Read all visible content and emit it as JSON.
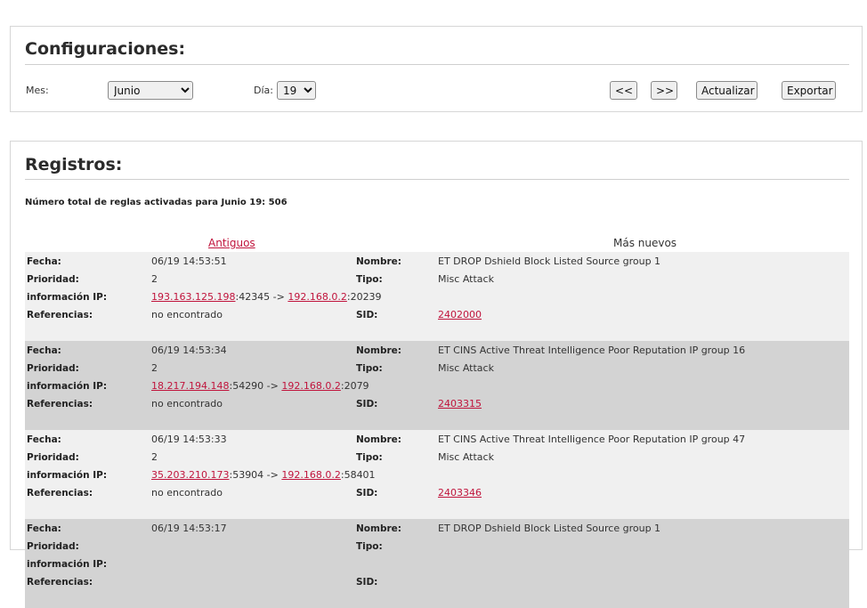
{
  "config": {
    "title": "Configuraciones:",
    "month_label": "Mes:",
    "month_value": "Junio",
    "day_label": "Día:",
    "day_value": "19",
    "prev_label": "<<",
    "next_label": ">>",
    "refresh_label": "Actualizar",
    "export_label": "Exportar"
  },
  "logs": {
    "title": "Registros:",
    "total_text": "Número total de reglas activadas para Junio 19: 506",
    "older_label": "Antiguos",
    "newer_label": "Más nuevos",
    "field_labels": {
      "date": "Fecha:",
      "priority": "Prioridad:",
      "ip_info": "información IP:",
      "references": "Referencias:",
      "name": "Nombre:",
      "type": "Tipo:",
      "sid": "SID:"
    },
    "arrow": " -> ",
    "records": [
      {
        "date": "06/19 14:53:51",
        "priority": "2",
        "src_ip": "193.163.125.198",
        "src_port": ":42345",
        "dst_ip": "192.168.0.2",
        "dst_port": ":20239",
        "references": "no encontrado",
        "name": "ET DROP Dshield Block Listed Source group 1",
        "type": "Misc Attack",
        "sid": "2402000"
      },
      {
        "date": "06/19 14:53:34",
        "priority": "2",
        "src_ip": "18.217.194.148",
        "src_port": ":54290",
        "dst_ip": "192.168.0.2",
        "dst_port": ":2079",
        "references": "no encontrado",
        "name": "ET CINS Active Threat Intelligence Poor Reputation IP group 16",
        "type": "Misc Attack",
        "sid": "2403315"
      },
      {
        "date": "06/19 14:53:33",
        "priority": "2",
        "src_ip": "35.203.210.173",
        "src_port": ":53904",
        "dst_ip": "192.168.0.2",
        "dst_port": ":58401",
        "references": "no encontrado",
        "name": "ET CINS Active Threat Intelligence Poor Reputation IP group 47",
        "type": "Misc Attack",
        "sid": "2403346"
      },
      {
        "date": "06/19 14:53:17",
        "priority": "",
        "src_ip": "",
        "src_port": "",
        "dst_ip": "",
        "dst_port": "",
        "references": "",
        "name": "ET DROP Dshield Block Listed Source group 1",
        "type": "",
        "sid": ""
      }
    ]
  },
  "colors": {
    "link": "#c0143c",
    "row_light": "#f0f0f0",
    "row_dark": "#d3d3d3"
  }
}
